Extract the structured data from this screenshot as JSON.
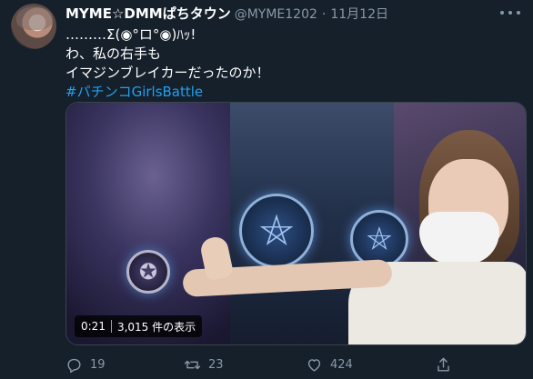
{
  "user": {
    "display_name": "MYME☆DMMぱちタウン",
    "handle": "@MYME1202",
    "separator": "·",
    "timestamp": "11月12日"
  },
  "tweet": {
    "lines": [
      "………Σ(◉°ロ°◉)ﾊｯ!",
      "わ、私の右手も",
      "イマジンブレイカーだったのか！"
    ],
    "hashtag": "#パチンコGirlsBattle"
  },
  "video": {
    "duration": "0:21",
    "views": "3,015 件の表示"
  },
  "actions": {
    "reply_count": "19",
    "retweet_count": "23",
    "like_count": "424"
  },
  "icons": {
    "more": "more-icon",
    "reply": "reply-icon",
    "retweet": "retweet-icon",
    "like": "heart-icon",
    "share": "share-icon"
  },
  "colors": {
    "background": "#15202b",
    "secondary_text": "#8899a6",
    "link": "#1da1f2"
  }
}
